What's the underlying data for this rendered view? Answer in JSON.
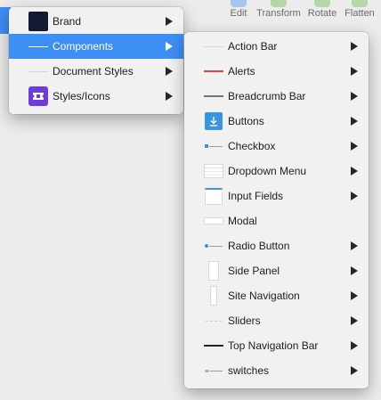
{
  "toolbar": {
    "buttons": [
      {
        "label": "Edit",
        "color": "#a4c8f0"
      },
      {
        "label": "Transform",
        "color": "#b4d7a8"
      },
      {
        "label": "Rotate",
        "color": "#b4d7a8"
      },
      {
        "label": "Flatten",
        "color": "#b4d7a8"
      }
    ]
  },
  "menu_primary": {
    "items": [
      {
        "label": "Brand",
        "thumb": "navy-swatch-icon"
      },
      {
        "label": "Components",
        "thumb": "white-line-icon",
        "highlighted": true
      },
      {
        "label": "Document Styles",
        "thumb": "gray-line-icon"
      },
      {
        "label": "Styles/Icons",
        "thumb": "purple-ticket-icon"
      }
    ]
  },
  "menu_components": {
    "items": [
      {
        "label": "Action Bar",
        "thumb": "light-line-icon"
      },
      {
        "label": "Alerts",
        "thumb": "red-line-icon"
      },
      {
        "label": "Breadcrumb Bar",
        "thumb": "slate-line-icon"
      },
      {
        "label": "Buttons",
        "thumb": "blue-download-icon"
      },
      {
        "label": "Checkbox",
        "thumb": "checkbox-thumb-icon"
      },
      {
        "label": "Dropdown Menu",
        "thumb": "dropdown-thumb-icon"
      },
      {
        "label": "Input Fields",
        "thumb": "input-thumb-icon"
      },
      {
        "label": "Modal",
        "thumb": "modal-thumb-icon"
      },
      {
        "label": "Radio Button",
        "thumb": "radio-thumb-icon"
      },
      {
        "label": "Side Panel",
        "thumb": "side-panel-thumb-icon"
      },
      {
        "label": "Site Navigation",
        "thumb": "site-nav-thumb-icon"
      },
      {
        "label": "Sliders",
        "thumb": "slider-thumb-icon"
      },
      {
        "label": "Top Navigation Bar",
        "thumb": "dark-line-icon"
      },
      {
        "label": "switches",
        "thumb": "switch-thumb-icon"
      }
    ]
  },
  "colors": {
    "highlight": "#3d8ff5",
    "menu_bg": "#f1f1f1",
    "brand_navy": "#121a33",
    "styles_purple": "#6e3bdc",
    "alert_red": "#e0443a",
    "button_blue": "#3a95db"
  }
}
